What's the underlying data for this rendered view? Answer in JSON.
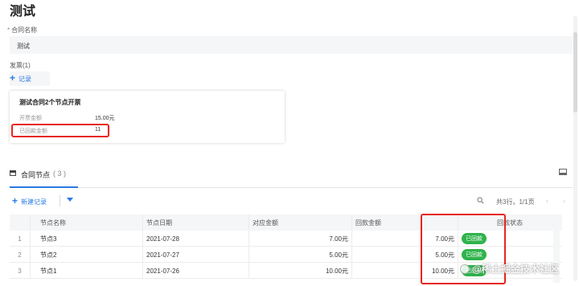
{
  "page": {
    "title": "测试"
  },
  "contract_field": {
    "required_mark": "*",
    "label": "合同名称",
    "value": "测试"
  },
  "invoices": {
    "label": "发票(1)",
    "add_button_label": "记录",
    "card": {
      "title": "测试合同2个节点开票",
      "rows": [
        {
          "label": "开票金额",
          "value": "15.00元"
        },
        {
          "label": "已回款金额",
          "value": "11"
        }
      ]
    }
  },
  "tabs": [
    {
      "label": "合同节点",
      "count": "( 3 )"
    }
  ],
  "toolbar": {
    "new_record_label": "新建记录",
    "pager_text": "共3行。1/1页",
    "prev": "‹",
    "next": "›"
  },
  "table": {
    "columns": [
      "节点名称",
      "节点日期",
      "对应金额",
      "回款金额",
      "回款状态"
    ],
    "rows": [
      {
        "index": "1",
        "name": "节点3",
        "date": "2021-07-28",
        "amount": "7.00元",
        "returned": "7.00元",
        "status": "已回款"
      },
      {
        "index": "2",
        "name": "节点2",
        "date": "2021-07-27",
        "amount": "5.00元",
        "returned": "5.00元",
        "status": "已回款"
      },
      {
        "index": "3",
        "name": "节点1",
        "date": "2021-07-26",
        "amount": "10.00元",
        "returned": "10.00元",
        "status": "已回款"
      }
    ]
  },
  "colors": {
    "accent": "#2a7ae2",
    "status_green": "#2fb34b",
    "highlight_red": "#e8261b"
  },
  "watermark": {
    "text": "@稀土掘金技术社区"
  }
}
